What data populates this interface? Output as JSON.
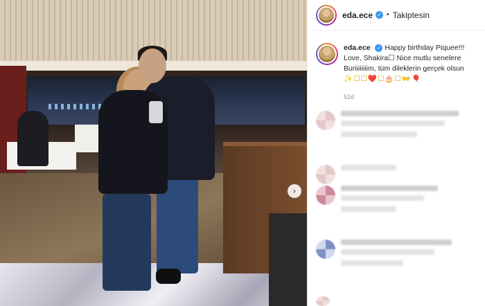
{
  "post": {
    "username": "eda.ece",
    "follow_status": "Takiptesin",
    "caption_lines": [
      "Happy birthday Piquee!!!",
      "Love, Shakira☐ Nice mutlu senelere",
      "Buriiiiiiiim, tüm dileklerin gerçek olsun"
    ],
    "caption_emojis": "✨☐☐❤️☐🎂☐👐🎈",
    "age": "51d"
  },
  "photo": {
    "next_icon": "›"
  },
  "colors": {
    "verified_blue": "#3897f0",
    "timestamp_gray": "#8e8e8e",
    "text": "#262626"
  }
}
